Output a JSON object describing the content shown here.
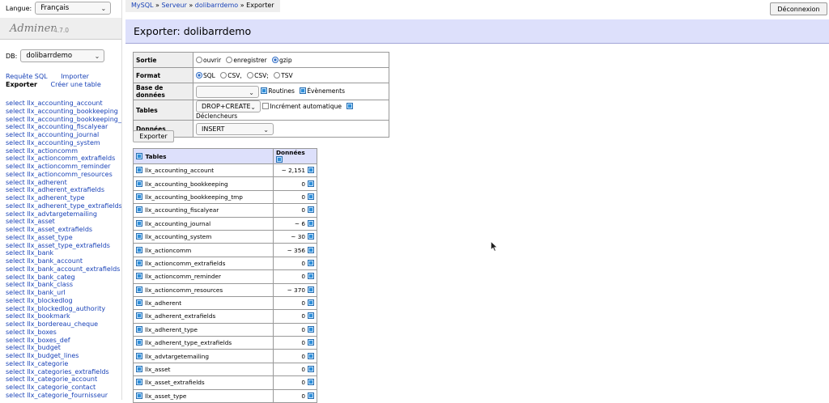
{
  "sidebar": {
    "lang_label": "Langue:",
    "lang_value": "Français",
    "brand": "Adminer",
    "version": "4.7.0",
    "db_label": "DB:",
    "db_value": "dolibarrdemo",
    "links": {
      "sql": "Requête SQL",
      "import": "Importer",
      "export": "Exporter",
      "create": "Créer une table"
    },
    "tables": [
      "select llx_accounting_account",
      "select llx_accounting_bookkeeping",
      "select llx_accounting_bookkeeping_t",
      "select llx_accounting_fiscalyear",
      "select llx_accounting_journal",
      "select llx_accounting_system",
      "select llx_actioncomm",
      "select llx_actioncomm_extrafields",
      "select llx_actioncomm_reminder",
      "select llx_actioncomm_resources",
      "select llx_adherent",
      "select llx_adherent_extrafields",
      "select llx_adherent_type",
      "select llx_adherent_type_extrafields",
      "select llx_advtargetemailing",
      "select llx_asset",
      "select llx_asset_extrafields",
      "select llx_asset_type",
      "select llx_asset_type_extrafields",
      "select llx_bank",
      "select llx_bank_account",
      "select llx_bank_account_extrafields",
      "select llx_bank_categ",
      "select llx_bank_class",
      "select llx_bank_url",
      "select llx_blockedlog",
      "select llx_blockedlog_authority",
      "select llx_bookmark",
      "select llx_bordereau_cheque",
      "select llx_boxes",
      "select llx_boxes_def",
      "select llx_budget",
      "select llx_budget_lines",
      "select llx_categorie",
      "select llx_categories_extrafields",
      "select llx_categorie_account",
      "select llx_categorie_contact",
      "select llx_categorie_fournisseur"
    ]
  },
  "breadcrumb": {
    "mysql": "MySQL",
    "sep": "»",
    "server": "Serveur",
    "db": "dolibarrdemo",
    "current": "Exporter"
  },
  "logout": "Déconnexion",
  "title": "Exporter: dolibarrdemo",
  "options": {
    "output": {
      "label": "Sortie",
      "items": [
        "ouvrir",
        "enregistrer",
        "gzip"
      ]
    },
    "format": {
      "label": "Format",
      "items": [
        "SQL",
        "CSV,",
        "CSV;",
        "TSV"
      ]
    },
    "database": {
      "label": "Base de données",
      "select": "",
      "routines": "Routines",
      "events": "Évènements"
    },
    "tables": {
      "label": "Tables",
      "select": "DROP+CREATE",
      "autoinc": "Incrément automatique",
      "triggers": "Déclencheurs"
    },
    "data": {
      "label": "Données",
      "select": "INSERT"
    }
  },
  "export_button": "Exporter",
  "table_header": {
    "tables": "Tables",
    "data": "Données"
  },
  "rows": [
    {
      "name": "llx_accounting_account",
      "count": "~ 2,151"
    },
    {
      "name": "llx_accounting_bookkeeping",
      "count": "0"
    },
    {
      "name": "llx_accounting_bookkeeping_tmp",
      "count": "0"
    },
    {
      "name": "llx_accounting_fiscalyear",
      "count": "0"
    },
    {
      "name": "llx_accounting_journal",
      "count": "~ 6"
    },
    {
      "name": "llx_accounting_system",
      "count": "~ 30"
    },
    {
      "name": "llx_actioncomm",
      "count": "~ 356"
    },
    {
      "name": "llx_actioncomm_extrafields",
      "count": "0"
    },
    {
      "name": "llx_actioncomm_reminder",
      "count": "0"
    },
    {
      "name": "llx_actioncomm_resources",
      "count": "~ 370"
    },
    {
      "name": "llx_adherent",
      "count": "0"
    },
    {
      "name": "llx_adherent_extrafields",
      "count": "0"
    },
    {
      "name": "llx_adherent_type",
      "count": "0"
    },
    {
      "name": "llx_adherent_type_extrafields",
      "count": "0"
    },
    {
      "name": "llx_advtargetemailing",
      "count": "0"
    },
    {
      "name": "llx_asset",
      "count": "0"
    },
    {
      "name": "llx_asset_extrafields",
      "count": "0"
    },
    {
      "name": "llx_asset_type",
      "count": "0"
    }
  ]
}
